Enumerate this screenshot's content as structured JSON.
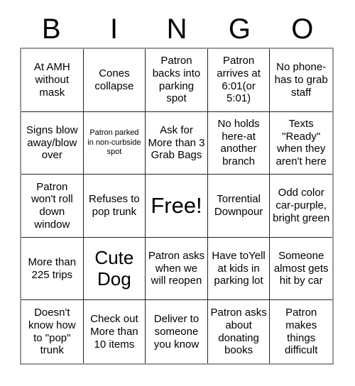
{
  "header": {
    "letters": [
      "B",
      "I",
      "N",
      "G",
      "O"
    ]
  },
  "grid": {
    "rows": 5,
    "columns": 5,
    "border_color": "#9a9a9a",
    "line_color": "#222222",
    "background": "#ffffff",
    "text_color": "#000000",
    "cells": [
      {
        "text": "At AMH without mask",
        "size": "normal"
      },
      {
        "text": "Cones collapse",
        "size": "normal"
      },
      {
        "text": "Patron backs into parking spot",
        "size": "normal"
      },
      {
        "text": "Patron arrives at 6:01(or 5:01)",
        "size": "normal"
      },
      {
        "text": "No phone- has to grab staff",
        "size": "normal"
      },
      {
        "text": "Signs blow away/blow over",
        "size": "normal"
      },
      {
        "text": "Patron parked in non-curbside spot",
        "size": "small"
      },
      {
        "text": "Ask for More than 3 Grab Bags",
        "size": "normal"
      },
      {
        "text": "No holds here-at another branch",
        "size": "normal"
      },
      {
        "text": "Texts \"Ready\" when they aren't here",
        "size": "normal"
      },
      {
        "text": "Patron won't roll down window",
        "size": "normal"
      },
      {
        "text": "Refuses to pop trunk",
        "size": "normal"
      },
      {
        "text": "Free!",
        "size": "free"
      },
      {
        "text": "Torrential Downpour",
        "size": "normal"
      },
      {
        "text": "Odd color car-purple, bright green",
        "size": "normal"
      },
      {
        "text": "More than 225 trips",
        "size": "normal"
      },
      {
        "text": "Cute Dog",
        "size": "large"
      },
      {
        "text": "Patron asks when we will reopen",
        "size": "normal"
      },
      {
        "text": "Have toYell at kids in parking lot",
        "size": "normal"
      },
      {
        "text": "Someone almost gets hit by car",
        "size": "normal"
      },
      {
        "text": "Doesn't know how to \"pop\" trunk",
        "size": "normal"
      },
      {
        "text": "Check out More than 10 items",
        "size": "normal"
      },
      {
        "text": "Deliver to someone you know",
        "size": "normal"
      },
      {
        "text": "Patron asks about donating books",
        "size": "normal"
      },
      {
        "text": "Patron makes things difficult",
        "size": "normal"
      }
    ]
  }
}
